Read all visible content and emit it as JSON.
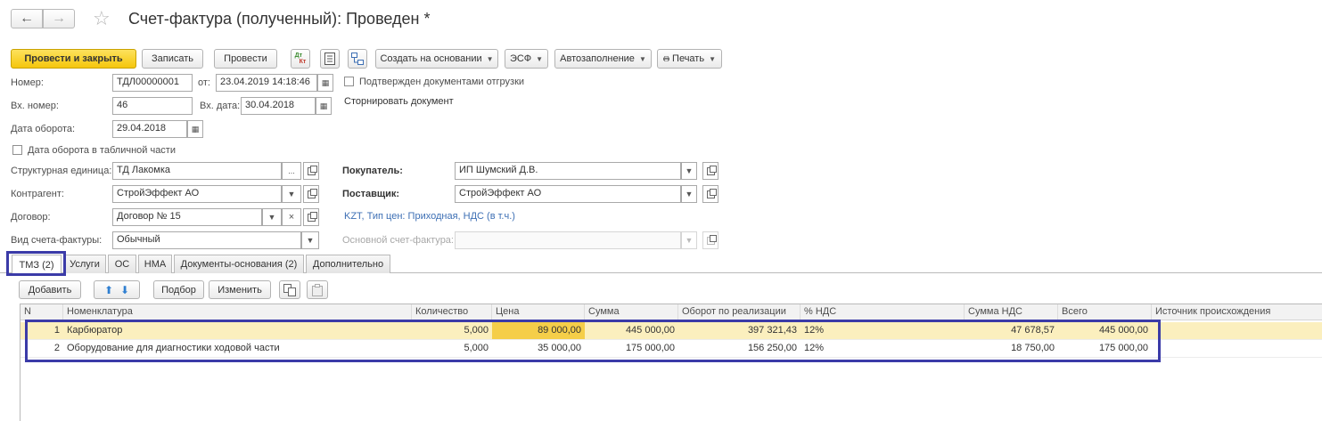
{
  "window": {
    "title": "Счет-фактура (полученный): Проведен *"
  },
  "toolbar": {
    "post_close": "Провести и закрыть",
    "write": "Записать",
    "post": "Провести",
    "create_based": "Создать на основании",
    "esf": "ЭСФ",
    "autofill": "Автозаполнение",
    "print": "Печать",
    "dtkt_top": "Дт",
    "dtkt_bottom": "Кт"
  },
  "form": {
    "number_label": "Номер:",
    "number": "ТДЛ00000001",
    "date_from_label": "от:",
    "date_from": "23.04.2019 14:18:46",
    "confirmed_label": "Подтвержден документами отгрузки",
    "in_number_label": "Вх. номер:",
    "in_number": "46",
    "in_date_label": "Вх. дата:",
    "in_date": "30.04.2018",
    "storno_label": "Сторнировать документ",
    "turnover_date_label": "Дата оборота:",
    "turnover_date": "29.04.2018",
    "turnover_in_table_label": "Дата оборота в табличной части",
    "unit_label": "Структурная единица:",
    "unit": "ТД Лакомка",
    "buyer_label": "Покупатель:",
    "buyer": "ИП Шумский Д.В.",
    "counterparty_label": "Контрагент:",
    "counterparty": "СтройЭффект АО",
    "supplier_label": "Поставщик:",
    "supplier": "СтройЭффект АО",
    "contract_label": "Договор:",
    "contract": "Договор № 15",
    "price_info": "KZT, Тип цен: Приходная, НДС (в т.ч.)",
    "invoice_kind_label": "Вид счета-фактуры:",
    "invoice_kind": "Обычный",
    "main_invoice_label": "Основной счет-фактура:",
    "main_invoice": ""
  },
  "tabs": [
    "ТМЗ (2)",
    "Услуги",
    "ОС",
    "НМА",
    "Документы-основания (2)",
    "Дополнительно"
  ],
  "table_toolbar": {
    "add": "Добавить",
    "pick": "Подбор",
    "edit": "Изменить"
  },
  "grid": {
    "columns": [
      "N",
      "Номенклатура",
      "Количество",
      "Цена",
      "Сумма",
      "Оборот по реализации",
      "% НДС",
      "Сумма НДС",
      "Всего",
      "Источник происхождения"
    ],
    "rows": [
      {
        "n": "1",
        "item": "Карбюратор",
        "qty": "5,000",
        "price": "89 000,00",
        "sum": "445 000,00",
        "turnover": "397 321,43",
        "vat_pct": "12%",
        "vat_sum": "47 678,57",
        "total": "445 000,00",
        "origin": ""
      },
      {
        "n": "2",
        "item": "Оборудование для диагностики ходовой части",
        "qty": "5,000",
        "price": "35 000,00",
        "sum": "175 000,00",
        "turnover": "156 250,00",
        "vat_pct": "12%",
        "vat_sum": "18 750,00",
        "total": "175 000,00",
        "origin": ""
      }
    ]
  },
  "colors": {
    "primary_button": "#f5c60c",
    "highlight_frame": "#3b3ba8",
    "selected_row": "#fbefbe",
    "current_cell": "#f5ce49",
    "link": "#3d6fb4"
  }
}
